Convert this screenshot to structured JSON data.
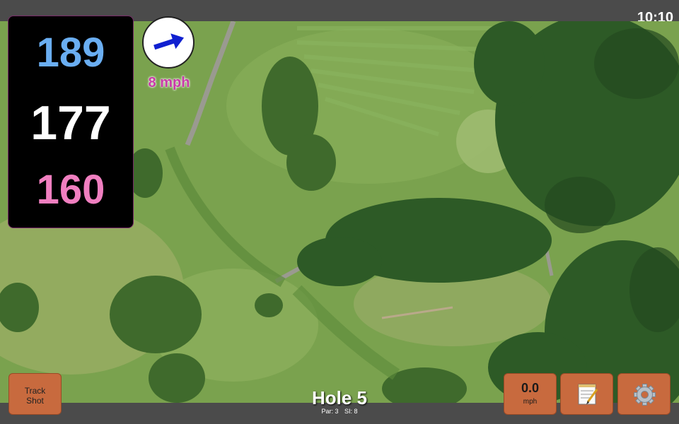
{
  "status_bar": {
    "time": "10:10"
  },
  "yardages": {
    "back": "189",
    "middle": "177",
    "front": "160"
  },
  "wind": {
    "speed_text": "8 mph",
    "direction_icon": "arrow-right-icon"
  },
  "buttons": {
    "track_shot_line1": "Track",
    "track_shot_line2": "Shot",
    "speed_value": "0.0",
    "speed_unit": "mph",
    "notes_icon": "notepad-icon",
    "settings_icon": "gear-icon"
  },
  "hole": {
    "title": "Hole 5",
    "par": "Par: 3",
    "si": "SI: 8"
  },
  "colors": {
    "back_yardage": "#6aaef2",
    "middle_yardage": "#ffffff",
    "front_yardage": "#f07fc0",
    "button": "#c86a3e",
    "wind_text": "#c93aa8"
  }
}
